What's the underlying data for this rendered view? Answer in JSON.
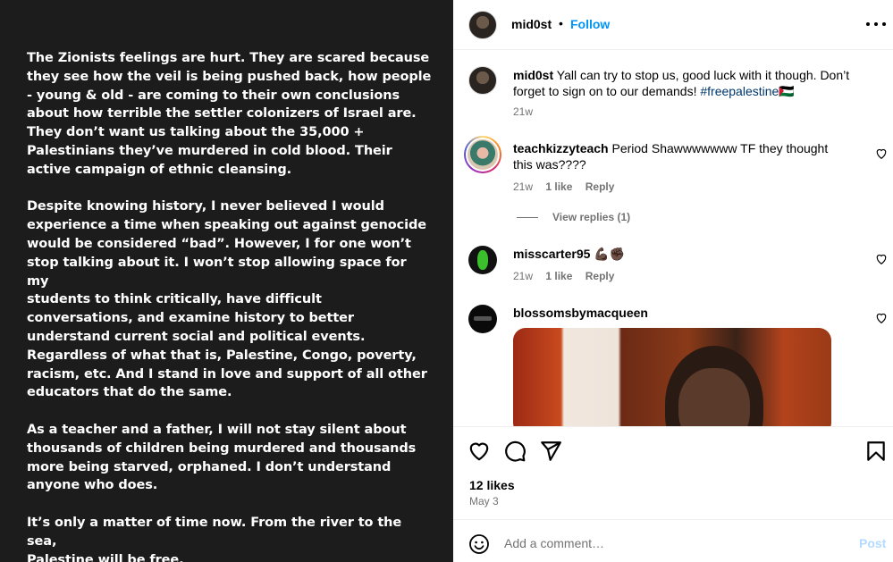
{
  "post_text": {
    "paragraphs": [
      "The Zionists feelings are hurt. They are scared because\nthey see how the veil is being pushed back, how people\n- young & old - are coming to their own conclusions\nabout how terrible the settler colonizers of Israel are.\nThey don’t want us talking about the 35,000 +\nPalestinians they’ve murdered in cold blood. Their\nactive campaign of ethnic cleansing.",
      "Despite knowing history, I never believed I would\nexperience a time when speaking out against genocide\nwould be considered “bad”. However, I for one won’t\nstop talking about it. I won’t stop allowing space for my\nstudents to think critically, have difficult\nconversations, and examine history to better\nunderstand current social and political events.\nRegardless of what that is, Palestine, Congo, poverty,\nracism, etc. And I stand in love and support of all other\neducators that do the same.",
      "As a teacher and a father, I will not stay silent about\nthousands of children being murdered and thousands\nmore being starved, orphaned. I don’t understand\nanyone who does.",
      "It’s only a matter of time now. From the river to the sea,\nPalestine will be free."
    ]
  },
  "header": {
    "username": "mid0st",
    "separator": "•",
    "follow_label": "Follow"
  },
  "caption": {
    "username": "mid0st",
    "text_line1": "Yall can try to stop us, good luck with it though. Don’t",
    "text_line2": "forget to sign on to our demands!",
    "hashtag": "#freepalestine",
    "flag_emoji": "🇵🇸",
    "time": "21w"
  },
  "comments": [
    {
      "username": "teachkizzyteach",
      "text_line1": "Period Shawwwwwww TF they thought",
      "text_line2": "this was????",
      "time": "21w",
      "likes": "1 like",
      "reply_label": "Reply",
      "view_replies": "View replies (1)"
    },
    {
      "username": "misscarter95",
      "emoji": "💪🏿✊🏿",
      "time": "21w",
      "likes": "1 like",
      "reply_label": "Reply"
    },
    {
      "username": "blossomsbymacqueen"
    }
  ],
  "actions": {
    "likes": "12 likes",
    "date": "May 3"
  },
  "add_comment": {
    "placeholder": "Add a comment…",
    "post_label": "Post"
  },
  "icons": [
    "more-options-icon",
    "heart-icon",
    "comment-icon",
    "share-icon",
    "bookmark-icon",
    "emoji-icon"
  ],
  "colors": {
    "left_bg": "#1c1c1c",
    "link_blue": "#0095f6",
    "hashtag_blue": "#00376b",
    "muted": "#737373",
    "post_disabled": "#b3dbff"
  }
}
